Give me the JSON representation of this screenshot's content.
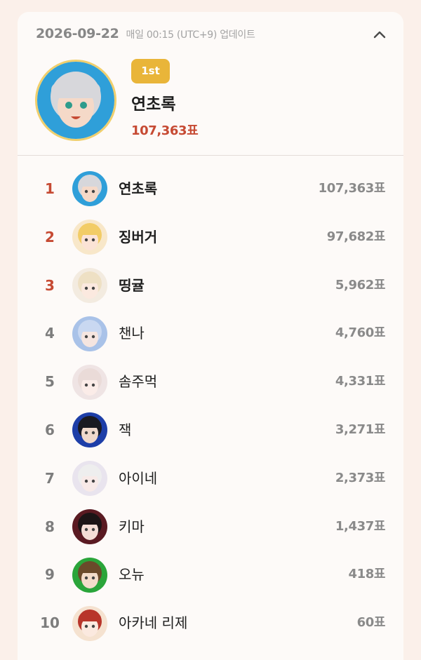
{
  "header": {
    "date": "2026-09-22",
    "update_note": "매일 00:15 (UTC+9) 업데이트",
    "collapse_icon": "chevron-up-icon"
  },
  "winner": {
    "badge": "1st",
    "name": "연초록",
    "votes": "107,363표",
    "avatar_colors": [
      "#2f9fd9",
      "#d9d9dc",
      "#f5d9c8"
    ]
  },
  "colors": {
    "accent_red": "#c64a33",
    "badge_gold": "#e9b539",
    "avatar_ring": "#f0cf6d",
    "background": "#fbf0ea",
    "card": "#fdfaf8"
  },
  "ranking": [
    {
      "rank": "1",
      "name": "연초록",
      "votes": "107,363표",
      "avatar_bg": "#2f9fd9",
      "avatar_hair": "#d7d7db",
      "avatar_face": "#f5d9c8"
    },
    {
      "rank": "2",
      "name": "징버거",
      "votes": "97,682표",
      "avatar_bg": "#f8e7c9",
      "avatar_hair": "#f2cc66",
      "avatar_face": "#fbe3d6"
    },
    {
      "rank": "3",
      "name": "띵귤",
      "votes": "5,962표",
      "avatar_bg": "#f3ebe0",
      "avatar_hair": "#eee0c4",
      "avatar_face": "#fbe9df"
    },
    {
      "rank": "4",
      "name": "챈나",
      "votes": "4,760표",
      "avatar_bg": "#a9c2e8",
      "avatar_hair": "#c9d8f1",
      "avatar_face": "#f5e5e0"
    },
    {
      "rank": "5",
      "name": "솜주먹",
      "votes": "4,331표",
      "avatar_bg": "#efe4e4",
      "avatar_hair": "#eadbd8",
      "avatar_face": "#fbece8"
    },
    {
      "rank": "6",
      "name": "잭",
      "votes": "3,271표",
      "avatar_bg": "#1d3ea8",
      "avatar_hair": "#1a1a22",
      "avatar_face": "#f0d9cc"
    },
    {
      "rank": "7",
      "name": "아이네",
      "votes": "2,373표",
      "avatar_bg": "#e9e4ee",
      "avatar_hair": "#eeeeee",
      "avatar_face": "#f8eae8"
    },
    {
      "rank": "8",
      "name": "키마",
      "votes": "1,437표",
      "avatar_bg": "#5a1a22",
      "avatar_hair": "#1c1416",
      "avatar_face": "#f4ddd6"
    },
    {
      "rank": "9",
      "name": "오뉴",
      "votes": "418표",
      "avatar_bg": "#2aa53a",
      "avatar_hair": "#6a4a2a",
      "avatar_face": "#f3dcc9"
    },
    {
      "rank": "10",
      "name": "아카네 리제",
      "votes": "60표",
      "avatar_bg": "#f5e2d0",
      "avatar_hair": "#b8352a",
      "avatar_face": "#fbe9df"
    }
  ]
}
